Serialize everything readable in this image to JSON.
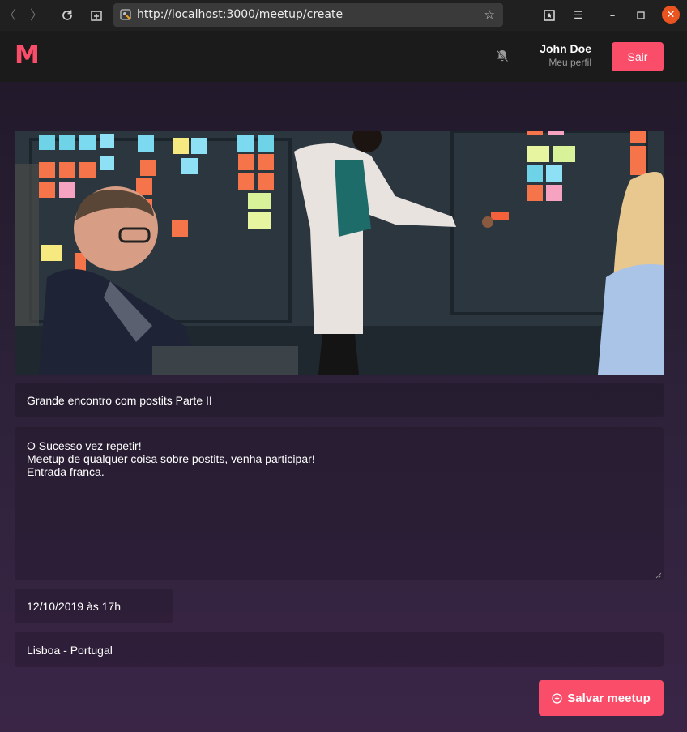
{
  "browser": {
    "url": "http://localhost:3000/meetup/create",
    "icons": [
      "back-icon",
      "forward-icon",
      "reload-icon",
      "new-tab-icon",
      "star-icon",
      "extension-icon",
      "menu-icon",
      "minimize-icon",
      "maximize-icon",
      "close-icon"
    ]
  },
  "header": {
    "logo": "M",
    "user_name": "John Doe",
    "profile_link": "Meu perfil",
    "logout_label": "Sair"
  },
  "form": {
    "title_value": "Grande encontro com postits Parte II",
    "description_lines": [
      "O Sucesso vez repetir!",
      "Meetup de qualquer coisa sobre postits, venha participar!",
      "Entrada franca."
    ],
    "date_value": "12/10/2019 às 17h",
    "location_value": "Lisboa - Portugal",
    "save_label": "Salvar meetup"
  },
  "colors": {
    "accent": "#f94d6a",
    "header_bg": "#1b1b1b",
    "page_bg_top": "#22192b",
    "page_bg_bottom": "#3a2546"
  }
}
